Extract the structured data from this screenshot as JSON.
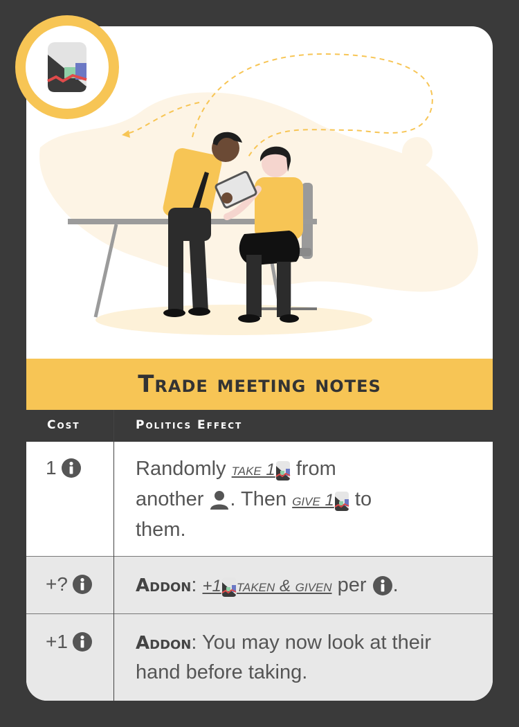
{
  "card": {
    "title": "Trade meeting notes",
    "header": {
      "cost": "Cost",
      "effect": "Politics Effect"
    },
    "rows": [
      {
        "cost": "1",
        "effect": {
          "t1": "Randomly",
          "take": "take 1",
          "t2": "from",
          "t3": "another",
          "t4": ". Then",
          "give": "give 1",
          "t5": "to",
          "t6": "them."
        }
      },
      {
        "cost": "+?",
        "effect": {
          "keyword": "Addon",
          "sep": ":",
          "plus": "+1",
          "taken": "taken & given",
          "t1": "per",
          "t2": "."
        }
      },
      {
        "cost": "+1",
        "effect": {
          "keyword": "Addon",
          "text": ": You may now look at their hand before taking."
        }
      }
    ]
  },
  "colors": {
    "accent": "#f7c555",
    "dark": "#3a3a3a",
    "row_alt": "#e8e8e8",
    "text": "#555555"
  },
  "icons": {
    "badge": "report-card-icon",
    "cost": "info-icon",
    "card": "report-card-icon",
    "person": "person-icon"
  }
}
